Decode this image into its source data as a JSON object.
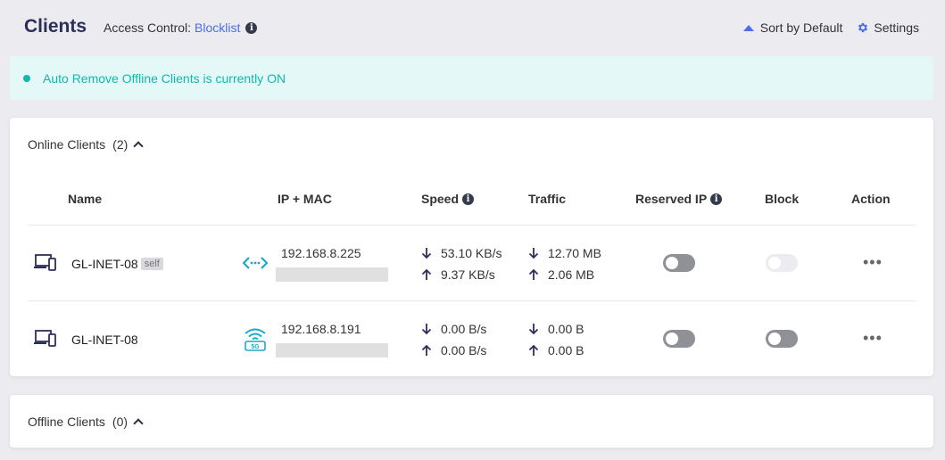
{
  "header": {
    "title": "Clients",
    "access_label": "Access Control:",
    "access_mode": "Blocklist",
    "sort_label": "Sort by Default",
    "settings_label": "Settings"
  },
  "banner": {
    "text": "Auto Remove Offline Clients is currently ON"
  },
  "online": {
    "title": "Online Clients",
    "count": "(2)",
    "columns": {
      "name": "Name",
      "ip_mac": "IP + MAC",
      "speed": "Speed",
      "traffic": "Traffic",
      "reserved_ip": "Reserved IP",
      "block": "Block",
      "action": "Action"
    },
    "clients": [
      {
        "name": "GL-INET-08",
        "badge": "self",
        "connection": "ethernet-icon",
        "ip": "192.168.8.225",
        "speed_down": "53.10 KB/s",
        "speed_up": "9.37 KB/s",
        "traffic_down": "12.70 MB",
        "traffic_up": "2.06 MB",
        "reserved_ip": false,
        "blocked": false,
        "block_disabled": true
      },
      {
        "name": "GL-INET-08",
        "connection": "wifi-5g-icon",
        "connection_label": "5G",
        "ip": "192.168.8.191",
        "speed_down": "0.00 B/s",
        "speed_up": "0.00 B/s",
        "traffic_down": "0.00 B",
        "traffic_up": "0.00 B",
        "reserved_ip": false,
        "blocked": false,
        "block_disabled": false
      }
    ],
    "more_label": "•••"
  },
  "offline": {
    "title": "Offline Clients",
    "count": "(0)"
  },
  "colors": {
    "accent": "#4b6de6",
    "teal": "#11b8ad",
    "banner_bg": "#e3f8f7",
    "toggle_off": "#8f9197",
    "wifi_icon": "#1aa9c9"
  }
}
